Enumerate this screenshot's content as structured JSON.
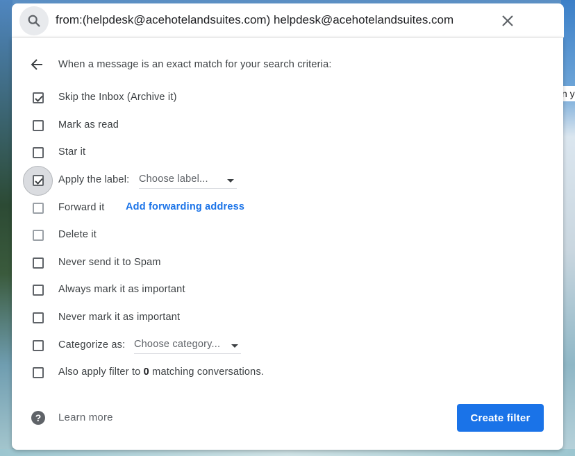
{
  "search": {
    "query": "from:(helpdesk@acehotelandsuites.com) helpdesk@acehotelandsuites.com",
    "search_icon": "search-icon",
    "clear_icon": "close-icon"
  },
  "background": {
    "partial_text": "n yo"
  },
  "filter": {
    "heading": "When a message is an exact match for your search criteria:",
    "back_icon": "arrow-back-icon",
    "options": [
      {
        "label": "Skip the Inbox (Archive it)",
        "checked": true
      },
      {
        "label": "Mark as read",
        "checked": false
      },
      {
        "label": "Star it",
        "checked": false
      },
      {
        "label": "Apply the label:",
        "checked": true,
        "dropdown": "Choose label..."
      },
      {
        "label": "Forward it",
        "checked": false,
        "link": "Add forwarding address"
      },
      {
        "label": "Delete it",
        "checked": false
      },
      {
        "label": "Never send it to Spam",
        "checked": false
      },
      {
        "label": "Always mark it as important",
        "checked": false
      },
      {
        "label": "Never mark it as important",
        "checked": false
      },
      {
        "label": "Categorize as:",
        "checked": false,
        "dropdown": "Choose category..."
      },
      {
        "label_prefix": "Also apply filter to ",
        "count": "0",
        "label_suffix": " matching conversations.",
        "checked": false
      }
    ],
    "learn_more": "Learn more",
    "help_icon": "help-icon",
    "create_button": "Create filter"
  },
  "colors": {
    "accent": "#1a73e8",
    "text": "#3c4043"
  }
}
